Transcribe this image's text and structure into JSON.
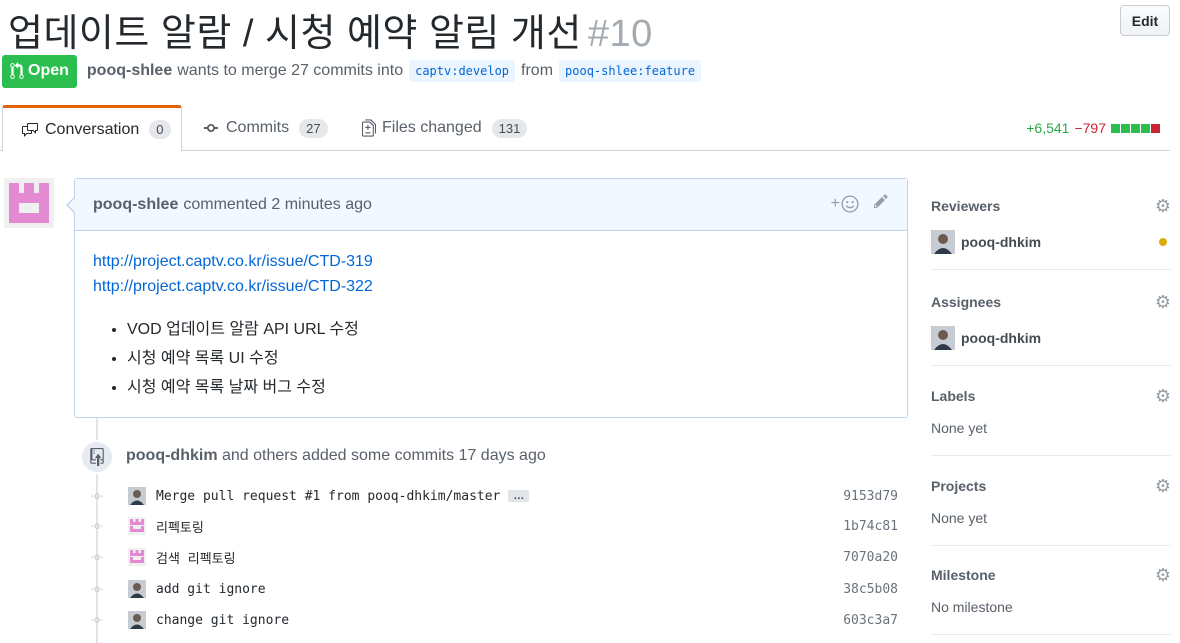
{
  "pr": {
    "title": "업데이트 알람 / 시청 예약 알림 개선",
    "number": "#10",
    "edit_label": "Edit",
    "state": "Open",
    "author": "pooq-shlee",
    "merge_text": "wants to merge 27 commits into",
    "base_branch": "captv:develop",
    "from_text": "from",
    "head_branch": "pooq-shlee:feature"
  },
  "tabs": [
    {
      "label": "Conversation",
      "count": "0",
      "icon": "conversation-icon"
    },
    {
      "label": "Commits",
      "count": "27",
      "icon": "commit-icon"
    },
    {
      "label": "Files changed",
      "count": "131",
      "icon": "diff-icon"
    }
  ],
  "diffstat": {
    "additions": "+6,541",
    "deletions": "−797",
    "blocks": [
      "#2cbe4e",
      "#2cbe4e",
      "#2cbe4e",
      "#2cbe4e",
      "#cb2431"
    ]
  },
  "comment": {
    "author": "pooq-shlee",
    "action": "commented 2 minutes ago",
    "links": [
      "http://project.captv.co.kr/issue/CTD-319",
      "http://project.captv.co.kr/issue/CTD-322"
    ],
    "bullets": [
      "VOD 업데이트 알람 API URL 수정",
      "시청 예약 목록 UI 수정",
      "시청 예약 목록 날짜 버그 수정"
    ]
  },
  "commits": {
    "author": "pooq-dhkim",
    "summary": "and others added some commits 17 days ago",
    "list": [
      {
        "message": "Merge pull request #1 from pooq-dhkim/master",
        "sha": "9153d79",
        "avatar": "photo",
        "has_more": true
      },
      {
        "message": "리펙토링",
        "sha": "1b74c81",
        "avatar": "identicon"
      },
      {
        "message": "검색 리펙토링",
        "sha": "7070a20",
        "avatar": "identicon"
      },
      {
        "message": "add git ignore",
        "sha": "38c5b08",
        "avatar": "photo"
      },
      {
        "message": "change git ignore",
        "sha": "603c3a7",
        "avatar": "photo"
      }
    ],
    "more_label": "…"
  },
  "sidebar": {
    "reviewers": {
      "title": "Reviewers",
      "user": "pooq-dhkim"
    },
    "assignees": {
      "title": "Assignees",
      "user": "pooq-dhkim"
    },
    "labels": {
      "title": "Labels",
      "value": "None yet"
    },
    "projects": {
      "title": "Projects",
      "value": "None yet"
    },
    "milestone": {
      "title": "Milestone",
      "value": "No milestone"
    }
  },
  "colors": {
    "open_green": "#2cbe4e",
    "link_blue": "#0366d6",
    "identicon_pink": "#e38ad3",
    "pending_yellow": "#dbab09"
  }
}
